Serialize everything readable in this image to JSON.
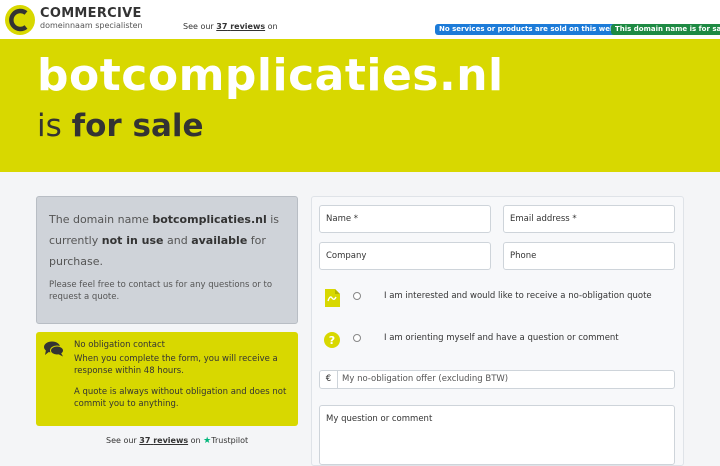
{
  "header": {
    "brand": "COMMERCIVE",
    "tagline": "domeinnaam specialisten",
    "reviews_prefix": "See our",
    "reviews_count": "37",
    "reviews_link": "reviews",
    "reviews_suffix": "on",
    "badge_no_sale": "No services or products are sold on this website.",
    "badge_for_sale": "This domain name is for sale"
  },
  "hero": {
    "domain": "botcomplicaties.nl",
    "is": "is",
    "for_sale": "for sale"
  },
  "info": {
    "p1_a": "The domain name",
    "p1_domain": "botcomplicaties.nl",
    "p1_b": "is currently",
    "p1_status": "not in use",
    "p1_c": "and",
    "p1_available": "available",
    "p1_d": "for purchase.",
    "p2": "Please feel free to contact us for any questions or to request a quote."
  },
  "contact_box": {
    "title": "No obligation contact",
    "text1": "When you complete the form, you will receive a response within 48 hours.",
    "text2": "A quote is always without obligation and does not commit you to anything."
  },
  "bottom_reviews": {
    "prefix": "See our",
    "count": "37",
    "link": "reviews",
    "suffix": "on",
    "brand": "Trustpilot"
  },
  "form": {
    "name_label": "Name *",
    "email_label": "Email address *",
    "company_label": "Company",
    "phone_label": "Phone",
    "option1": "I am interested and would like to receive a no-obligation quote",
    "option2": "I am orienting myself and have a question or comment",
    "currency": "€",
    "offer_placeholder": "My no-obligation offer (excluding BTW)",
    "question_label": "My question or comment"
  },
  "colors": {
    "accent": "#d8d800",
    "badge_blue": "#1c7bd8",
    "badge_green": "#1e8a43",
    "trustpilot": "#00b67a"
  },
  "icons": [
    "commercive-logo-icon",
    "chat-icon",
    "document-icon",
    "question-icon",
    "star-icon"
  ]
}
